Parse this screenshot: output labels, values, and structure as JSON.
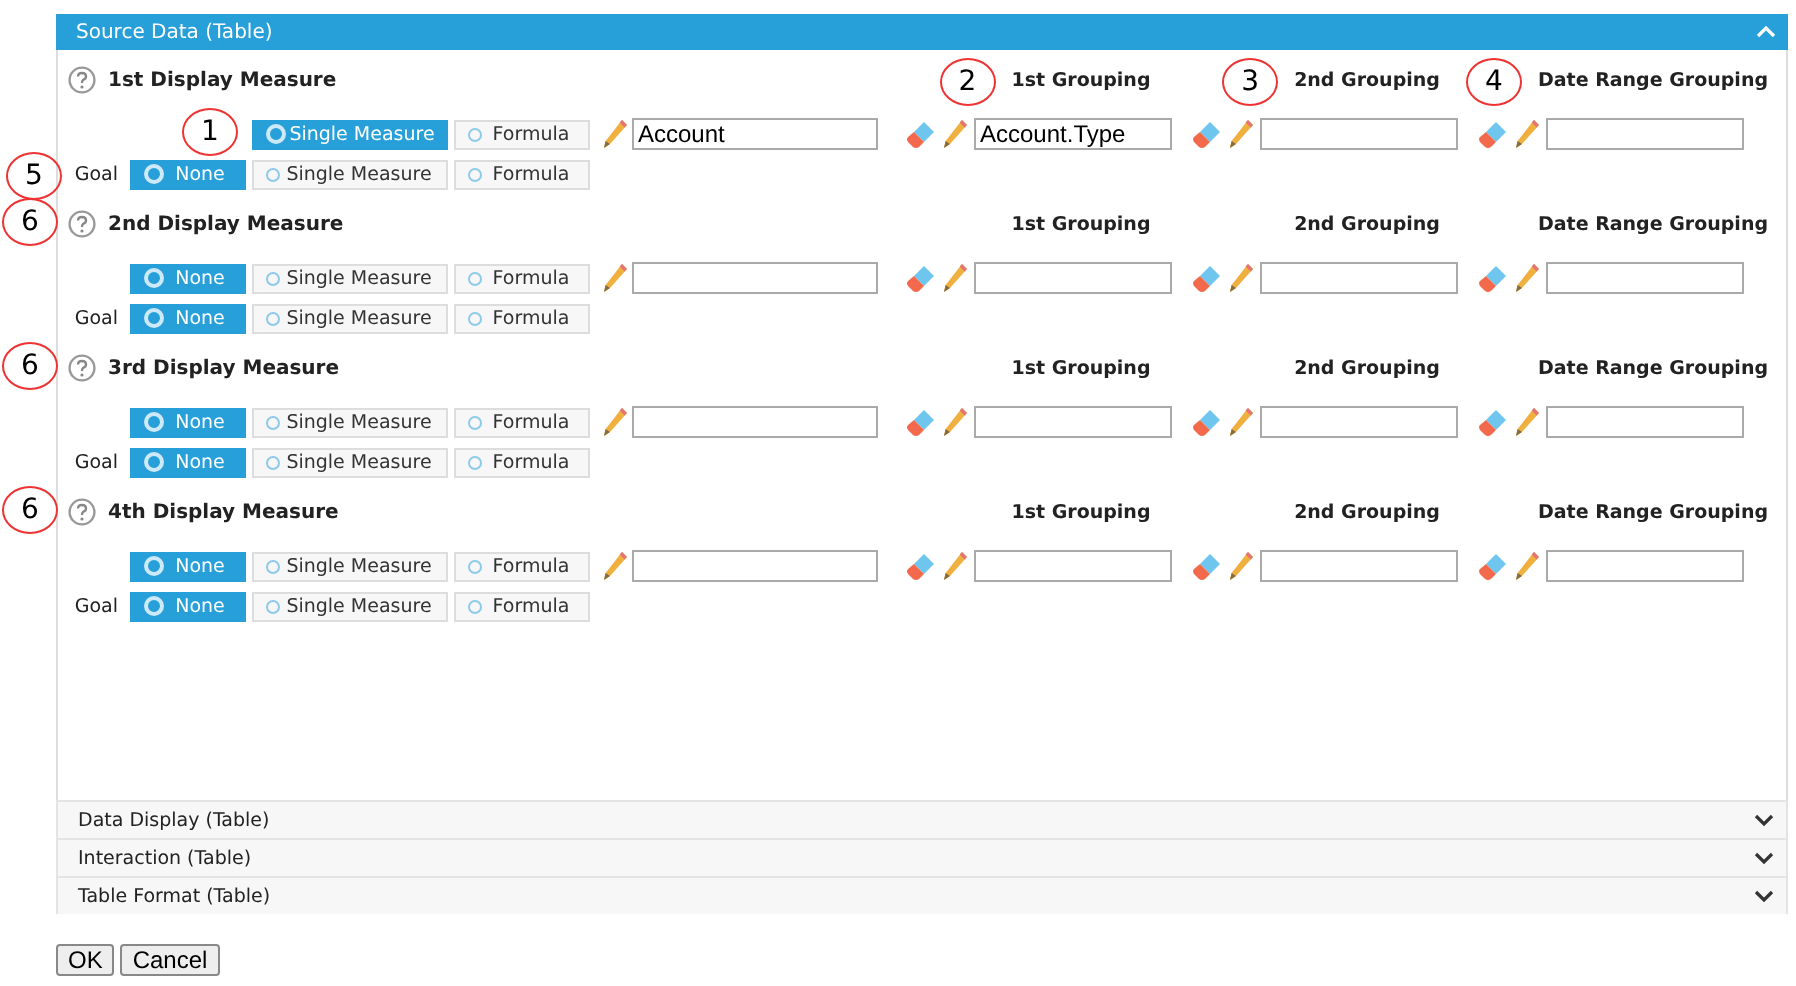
{
  "panel": {
    "title": "Source Data (Table)",
    "expanded": true,
    "measures": [
      {
        "title": "1st Display Measure",
        "options_callout": "1",
        "options": [
          {
            "label": "Single Measure",
            "selected": true
          },
          {
            "label": "Formula",
            "selected": false
          }
        ],
        "goal": {
          "label": "Goal",
          "callout": "5",
          "options": [
            {
              "label": "None",
              "selected": true
            },
            {
              "label": "Single Measure",
              "selected": false
            },
            {
              "label": "Formula",
              "selected": false
            }
          ]
        },
        "field": {
          "value": "Account"
        },
        "groupings": [
          {
            "label": "1st Grouping",
            "callout": "2",
            "value": "Account.Type"
          },
          {
            "label": "2nd Grouping",
            "callout": "3"
          },
          {
            "label": "Date Range Grouping",
            "callout": "4"
          }
        ]
      },
      {
        "title_callout": "6",
        "title": "2nd Display Measure",
        "options": [
          {
            "label": "None",
            "selected": true
          },
          {
            "label": "Single Measure",
            "selected": false
          },
          {
            "label": "Formula",
            "selected": false
          }
        ],
        "goal": {
          "label": "Goal",
          "options": [
            {
              "label": "None",
              "selected": true
            },
            {
              "label": "Single Measure",
              "selected": false
            },
            {
              "label": "Formula",
              "selected": false
            }
          ]
        },
        "groupings": [
          {
            "label": "1st Grouping"
          },
          {
            "label": "2nd Grouping"
          },
          {
            "label": "Date Range Grouping"
          }
        ]
      },
      {
        "title_callout": "6",
        "title": "3rd Display Measure",
        "options": [
          {
            "label": "None",
            "selected": true
          },
          {
            "label": "Single Measure",
            "selected": false
          },
          {
            "label": "Formula",
            "selected": false
          }
        ],
        "goal": {
          "label": "Goal",
          "options": [
            {
              "label": "None",
              "selected": true
            },
            {
              "label": "Single Measure",
              "selected": false
            },
            {
              "label": "Formula",
              "selected": false
            }
          ]
        },
        "groupings": [
          {
            "label": "1st Grouping"
          },
          {
            "label": "2nd Grouping"
          },
          {
            "label": "Date Range Grouping"
          }
        ]
      },
      {
        "title_callout": "6",
        "title": "4th Display Measure",
        "options": [
          {
            "label": "None",
            "selected": true
          },
          {
            "label": "Single Measure",
            "selected": false
          },
          {
            "label": "Formula",
            "selected": false
          }
        ],
        "goal": {
          "label": "Goal",
          "options": [
            {
              "label": "None",
              "selected": true
            },
            {
              "label": "Single Measure",
              "selected": false
            },
            {
              "label": "Formula",
              "selected": false
            }
          ]
        },
        "groupings": [
          {
            "label": "1st Grouping"
          },
          {
            "label": "2nd Grouping"
          },
          {
            "label": "Date Range Grouping"
          }
        ]
      }
    ]
  },
  "sections": [
    {
      "title": "Data Display (Table)",
      "expanded": false
    },
    {
      "title": "Interaction (Table)",
      "expanded": false
    },
    {
      "title": "Table Format (Table)",
      "expanded": false
    }
  ],
  "buttons": [
    "OK",
    "Cancel"
  ]
}
